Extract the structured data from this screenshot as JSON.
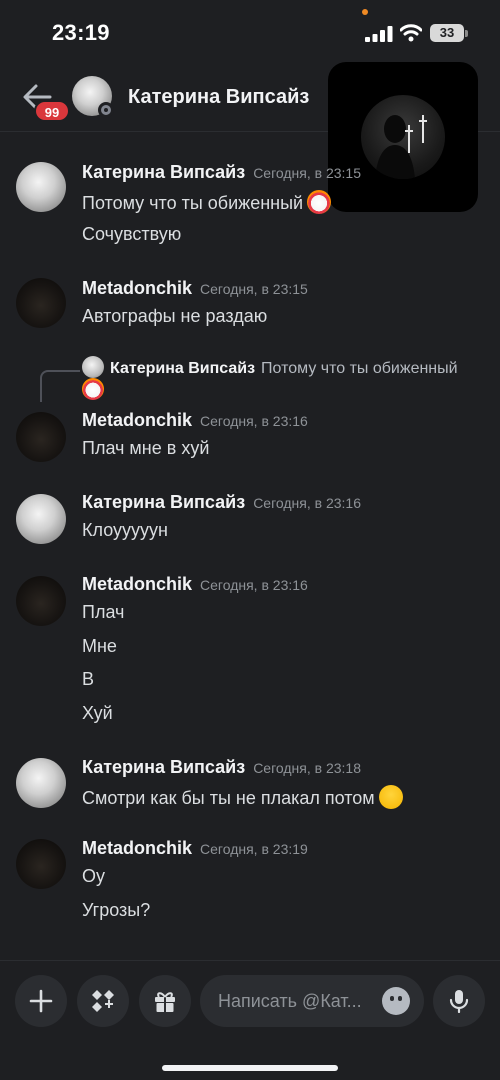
{
  "status_bar": {
    "time": "23:19",
    "battery": "33"
  },
  "header": {
    "badge_count": "99",
    "contact_name": "Катерина Випсайз"
  },
  "reply_preview": {
    "author": "Катерина Випсайз",
    "text": "Потому что ты обиженный"
  },
  "messages": [
    {
      "author": "Катерина Випсайз",
      "timestamp": "Сегодня, в 23:15",
      "lines": [
        "Потому что ты обиженный",
        "Сочувствую"
      ]
    },
    {
      "author": "Metadonchik",
      "timestamp": "Сегодня, в 23:15",
      "lines": [
        "Автографы не раздаю"
      ]
    },
    {
      "author": "Metadonchik",
      "timestamp": "Сегодня, в 23:16",
      "lines": [
        "Плач мне в хуй"
      ]
    },
    {
      "author": "Катерина Випсайз",
      "timestamp": "Сегодня, в 23:16",
      "lines": [
        "Клоууууун"
      ]
    },
    {
      "author": "Metadonchik",
      "timestamp": "Сегодня, в 23:16",
      "lines": [
        "Плач",
        "Мне",
        "В",
        "Хуй"
      ]
    },
    {
      "author": "Катерина Випсайз",
      "timestamp": "Сегодня, в 23:18",
      "lines": [
        "Смотри как бы ты не плакал потом"
      ]
    },
    {
      "author": "Metadonchik",
      "timestamp": "Сегодня, в 23:19",
      "lines": [
        "Оу",
        "Угрозы?"
      ]
    }
  ],
  "composer": {
    "placeholder": "Написать @Кат..."
  },
  "icons": {
    "back": "arrow-left-icon",
    "add": "plus-icon",
    "apps": "apps-icon",
    "gift": "gift-icon",
    "emoji": "smile-icon",
    "mic": "mic-icon"
  },
  "colors": {
    "background": "#1e1f22",
    "badge": "#da373c",
    "field": "#2b2d31",
    "muted": "#8e9297"
  }
}
